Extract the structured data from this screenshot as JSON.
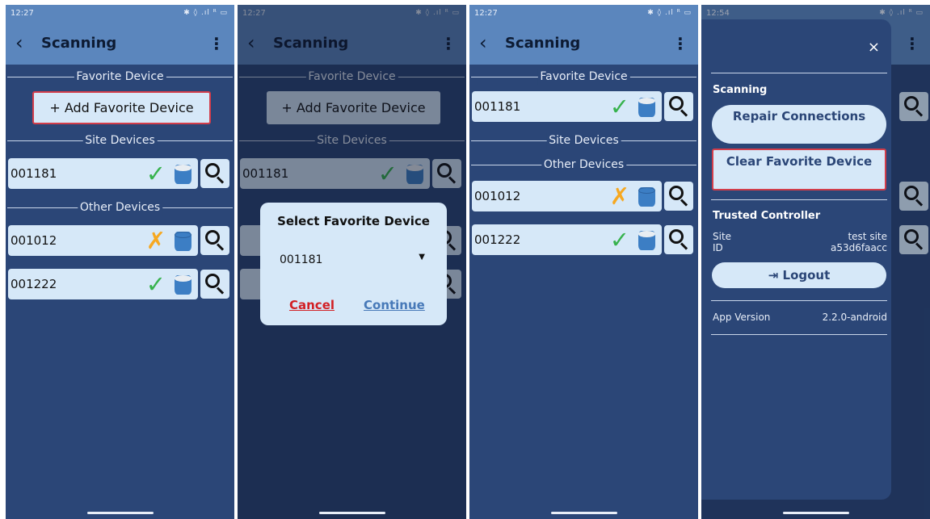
{
  "panels": [
    {
      "time": "12:27",
      "status_icons": "✱ ◊ .ıl ᴿ ▭",
      "title": "Scanning",
      "favorite_section": "Favorite Device",
      "add_favorite_label": "+ Add Favorite Device",
      "site_section": "Site Devices",
      "other_section": "Other Devices",
      "site_devices": [
        {
          "id": "001181",
          "status": "✓",
          "status_type": "connected"
        }
      ],
      "other_devices": [
        {
          "id": "001012",
          "status": "✗",
          "status_type": "disconnected"
        },
        {
          "id": "001222",
          "status": "✓",
          "status_type": "connected"
        }
      ]
    },
    {
      "time": "12:27",
      "status_icons": "✱ ◊ .ıl ᴿ ▭",
      "title": "Scanning",
      "favorite_section": "Favorite Device",
      "add_favorite_label": "+ Add Favorite Device",
      "site_section": "Site Devices",
      "other_section": "Other Devices",
      "site_devices": [
        {
          "id": "001181",
          "status": "✓"
        }
      ],
      "dialog": {
        "title": "Select Favorite Device",
        "selected": "001181",
        "cancel_label": "Cancel",
        "continue_label": "Continue"
      }
    },
    {
      "time": "12:27",
      "status_icons": "✱ ◊ .ıl ᴿ ▭",
      "title": "Scanning",
      "favorite_section": "Favorite Device",
      "favorite_device": {
        "id": "001181",
        "status": "✓"
      },
      "site_section": "Site Devices",
      "other_section": "Other Devices",
      "other_devices": [
        {
          "id": "001012",
          "status": "✗"
        },
        {
          "id": "001222",
          "status": "✓"
        }
      ]
    },
    {
      "time": "12:54",
      "status_icons": "✱ ◊ .ıl ᴿ ▭",
      "drawer": {
        "close": "×",
        "section_title": "Scanning",
        "repair_label": "Repair Connections",
        "clear_label": "Clear Favorite Device",
        "trusted_title": "Trusted Controller",
        "site_key": "Site",
        "site_value": "test site",
        "id_key": "ID",
        "id_value": "a53d6faacc",
        "logout_label": "⇥ Logout",
        "version_key": "App Version",
        "version_value": "2.2.0-android"
      }
    }
  ],
  "colors": {
    "background": "#2b4677",
    "header": "#5b86bd",
    "card": "#d6e8f8",
    "ok": "#37b24d",
    "fail": "#f6a821",
    "highlight": "#d33d4a"
  },
  "icons": [
    "back-chevron-icon",
    "kebab-menu-icon",
    "check-icon",
    "cross-icon",
    "cylinder-icon",
    "search-icon",
    "close-icon",
    "logout-icon"
  ]
}
